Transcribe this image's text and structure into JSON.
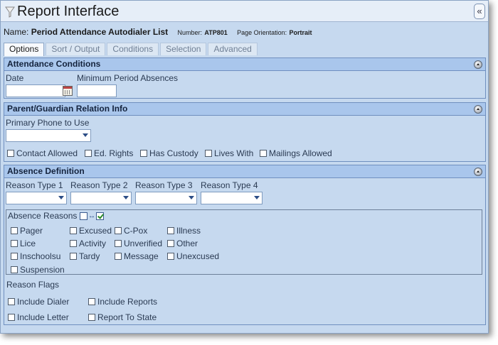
{
  "window": {
    "title": "Report Interface",
    "collapse_glyph": "«"
  },
  "report": {
    "name_label": "Name:",
    "name_value": "Period Attendance Autodialer List",
    "number_label": "Number:",
    "number_value": "ATP801",
    "orientation_label": "Page Orientation:",
    "orientation_value": "Portrait"
  },
  "tabs": [
    {
      "label": "Options",
      "active": true
    },
    {
      "label": "Sort / Output",
      "active": false
    },
    {
      "label": "Conditions",
      "active": false
    },
    {
      "label": "Selection",
      "active": false
    },
    {
      "label": "Advanced",
      "active": false
    }
  ],
  "attendance": {
    "header": "Attendance Conditions",
    "date_label": "Date",
    "date_value": "",
    "min_absences_label": "Minimum Period Absences",
    "min_absences_value": ""
  },
  "guardian": {
    "header": "Parent/Guardian Relation Info",
    "phone_label": "Primary Phone to Use",
    "phone_value": "",
    "checkboxes": [
      "Contact Allowed",
      "Ed. Rights",
      "Has Custody",
      "Lives With",
      "Mailings Allowed"
    ]
  },
  "absence": {
    "header": "Absence Definition",
    "reason_types": [
      "Reason Type 1",
      "Reason Type 2",
      "Reason Type 3",
      "Reason Type 4"
    ],
    "reasons_label": "Absence Reasons",
    "reasons_cols": [
      [
        "Pager",
        "Lice",
        "Inschoolsu",
        "Suspension"
      ],
      [
        "Excused",
        "Activity",
        "Tardy"
      ],
      [
        "C-Pox",
        "Unverified",
        "Message"
      ],
      [
        "Illness",
        "Other",
        "Unexcused"
      ]
    ],
    "flags_label": "Reason Flags",
    "flags": [
      "Include Dialer",
      "Include Reports",
      "Include Letter",
      "Report To State"
    ]
  },
  "colors": {
    "panel_bg": "#c6d9ef",
    "header_bg": "#a9c6ec",
    "border": "#6f8fbf"
  }
}
